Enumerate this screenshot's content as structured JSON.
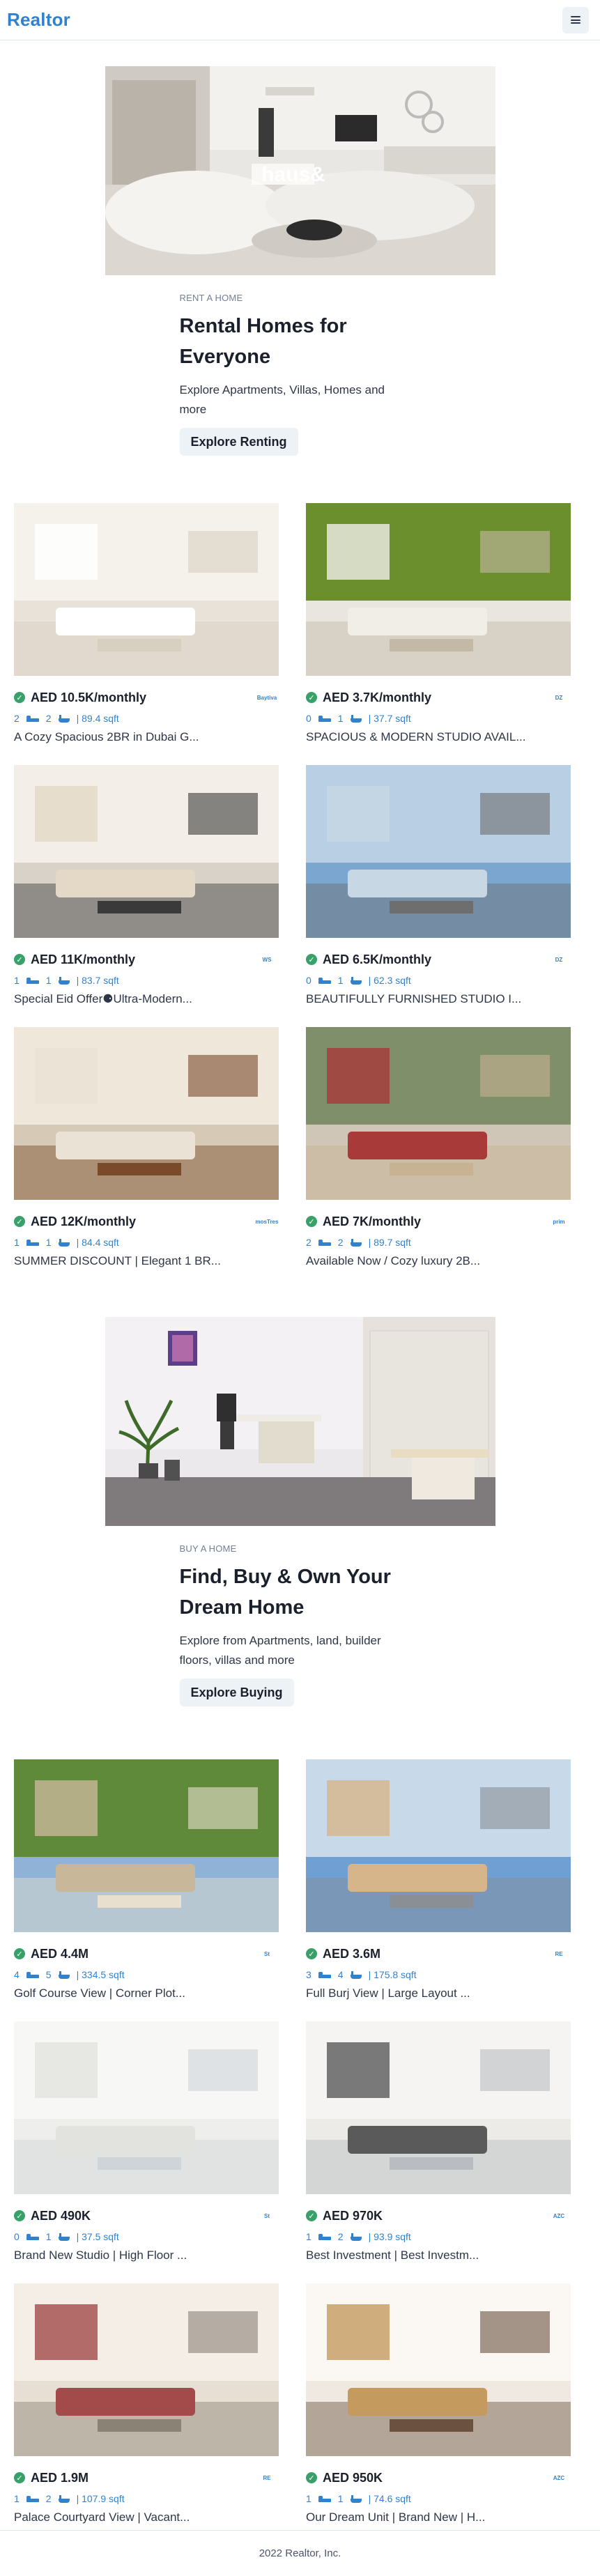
{
  "header": {
    "logo": "Realtor"
  },
  "banner_rent": {
    "eyebrow": "RENT A HOME",
    "title": "Rental Homes for Everyone",
    "desc": "Explore Apartments, Villas, Homes and more",
    "button": "Explore Renting",
    "watermark": "haus&"
  },
  "rent_listings": [
    {
      "price": "AED 10.5K/monthly",
      "beds": "2",
      "baths": "2",
      "area": "| 89.4 sqft",
      "title": "A Cozy Spacious 2BR in Dubai G...",
      "agency": "Baytiva"
    },
    {
      "price": "AED 3.7K/monthly",
      "beds": "0",
      "baths": "1",
      "area": "| 37.7 sqft",
      "title": "SPACIOUS & MODERN STUDIO AVAIL...",
      "agency": "DZ"
    },
    {
      "price": "AED 11K/monthly",
      "beds": "1",
      "baths": "1",
      "area": "| 83.7 sqft",
      "title": "Special Eid Offer⚈Ultra-Modern...",
      "agency": "WS"
    },
    {
      "price": "AED 6.5K/monthly",
      "beds": "0",
      "baths": "1",
      "area": "| 62.3 sqft",
      "title": "BEAUTIFULLY FURNISHED STUDIO I...",
      "agency": "DZ"
    },
    {
      "price": "AED 12K/monthly",
      "beds": "1",
      "baths": "1",
      "area": "| 84.4 sqft",
      "title": "SUMMER DISCOUNT | Elegant 1 BR...",
      "agency": "mosTres"
    },
    {
      "price": "AED 7K/monthly",
      "beds": "2",
      "baths": "2",
      "area": "| 89.7 sqft",
      "title": "Available Now / Cozy luxury 2B...",
      "agency": "prim"
    }
  ],
  "banner_buy": {
    "eyebrow": "BUY A HOME",
    "title": "Find, Buy & Own Your Dream Home",
    "desc": "Explore from Apartments, land, builder floors, villas and more",
    "button": "Explore Buying"
  },
  "buy_listings": [
    {
      "price": "AED 4.4M",
      "beds": "4",
      "baths": "5",
      "area": "| 334.5 sqft",
      "title": "Golf Course View | Corner Plot...",
      "agency": "St"
    },
    {
      "price": "AED 3.6M",
      "beds": "3",
      "baths": "4",
      "area": "| 175.8 sqft",
      "title": "Full Burj View | Large Layout ...",
      "agency": "RE"
    },
    {
      "price": "AED 490K",
      "beds": "0",
      "baths": "1",
      "area": "| 37.5 sqft",
      "title": "Brand New Studio | High Floor ...",
      "agency": "St"
    },
    {
      "price": "AED 970K",
      "beds": "1",
      "baths": "2",
      "area": "| 93.9 sqft",
      "title": "Best Investment | Best Investm...",
      "agency": "AZC"
    },
    {
      "price": "AED 1.9M",
      "beds": "1",
      "baths": "2",
      "area": "| 107.9 sqft",
      "title": "Palace Courtyard View | Vacant...",
      "agency": "RE"
    },
    {
      "price": "AED 950K",
      "beds": "1",
      "baths": "1",
      "area": "| 74.6 sqft",
      "title": "Our Dream Unit | Brand New | H...",
      "agency": "AZC"
    }
  ],
  "footer": {
    "text": "2022 Realtor, Inc."
  },
  "colors": {
    "brand": "#3182ce",
    "verified": "#38a169",
    "button_bg": "#edf2f7"
  }
}
